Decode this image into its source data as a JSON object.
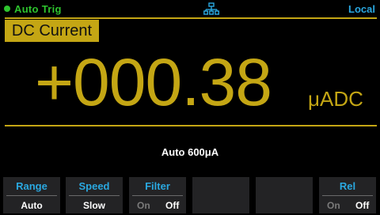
{
  "status": {
    "trigger": "Auto Trig",
    "remote": "Local",
    "network_icon": "lan-network-icon"
  },
  "function": "DC Current",
  "reading": {
    "value": "+000.38",
    "unit": "μADC"
  },
  "range_info": "Auto  600μA",
  "softkeys": [
    {
      "title": "Range",
      "value": "Auto"
    },
    {
      "title": "Speed",
      "value": "Slow"
    },
    {
      "title": "Filter",
      "option_a": "On",
      "option_b": "Off",
      "selected": "Off"
    },
    {
      "title": ""
    },
    {
      "title": ""
    },
    {
      "title": "Rel",
      "option_a": "On",
      "option_b": "Off",
      "selected": "Off"
    }
  ],
  "colors": {
    "accent": "#c4a614",
    "status_green": "#2ec42e",
    "softkey_blue": "#2aa8e0",
    "softkey_bg": "#232325"
  }
}
